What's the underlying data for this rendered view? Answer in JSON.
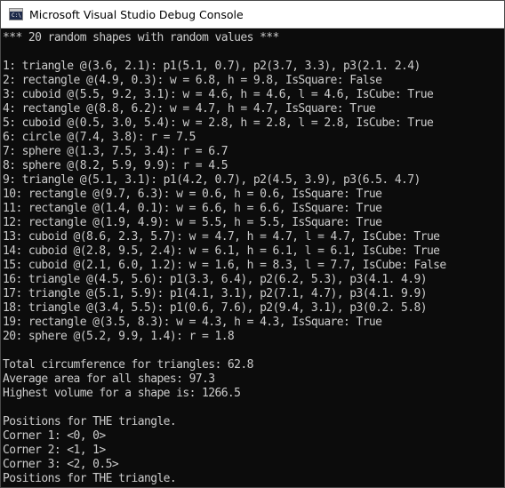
{
  "window": {
    "title": "Microsoft Visual Studio Debug Console",
    "icon": "console-app-icon",
    "icon_glyph": "C:\\"
  },
  "console": {
    "lines": [
      "*** 20 random shapes with random values ***",
      "",
      "1: triangle @(3.6, 2.1): p1(5.1, 0.7), p2(3.7, 3.3), p3(2.1. 2.4)",
      "2: rectangle @(4.9, 0.3): w = 6.8, h = 9.8, IsSquare: False",
      "3: cuboid @(5.5, 9.2, 3.1): w = 4.6, h = 4.6, l = 4.6, IsCube: True",
      "4: rectangle @(8.8, 6.2): w = 4.7, h = 4.7, IsSquare: True",
      "5: cuboid @(0.5, 3.0, 5.4): w = 2.8, h = 2.8, l = 2.8, IsCube: True",
      "6: circle @(7.4, 3.8): r = 7.5",
      "7: sphere @(1.3, 7.5, 3.4): r = 6.7",
      "8: sphere @(8.2, 5.9, 9.9): r = 4.5",
      "9: triangle @(5.1, 3.1): p1(4.2, 0.7), p2(4.5, 3.9), p3(6.5. 4.7)",
      "10: rectangle @(9.7, 6.3): w = 0.6, h = 0.6, IsSquare: True",
      "11: rectangle @(1.4, 0.1): w = 6.6, h = 6.6, IsSquare: True",
      "12: rectangle @(1.9, 4.9): w = 5.5, h = 5.5, IsSquare: True",
      "13: cuboid @(8.6, 2.3, 5.7): w = 4.7, h = 4.7, l = 4.7, IsCube: True",
      "14: cuboid @(2.8, 9.5, 2.4): w = 6.1, h = 6.1, l = 6.1, IsCube: True",
      "15: cuboid @(2.1, 6.0, 1.2): w = 1.6, h = 8.3, l = 7.7, IsCube: False",
      "16: triangle @(4.5, 5.6): p1(3.3, 6.4), p2(6.2, 5.3), p3(4.1. 4.9)",
      "17: triangle @(5.1, 5.9): p1(4.1, 3.1), p2(7.1, 4.7), p3(4.1. 9.9)",
      "18: triangle @(3.4, 5.5): p1(0.6, 7.6), p2(9.4, 3.1), p3(0.2. 5.8)",
      "19: rectangle @(3.5, 8.3): w = 4.3, h = 4.3, IsSquare: True",
      "20: sphere @(5.2, 9.9, 1.4): r = 1.8",
      "",
      "Total circumference for triangles: 62.8",
      "Average area for all shapes: 97.3",
      "Highest volume for a shape is: 1266.5",
      "",
      "Positions for THE triangle.",
      "Corner 1: <0, 0>",
      "Corner 2: <1, 1>",
      "Corner 3: <2, 0.5>",
      "Positions for THE triangle."
    ]
  }
}
